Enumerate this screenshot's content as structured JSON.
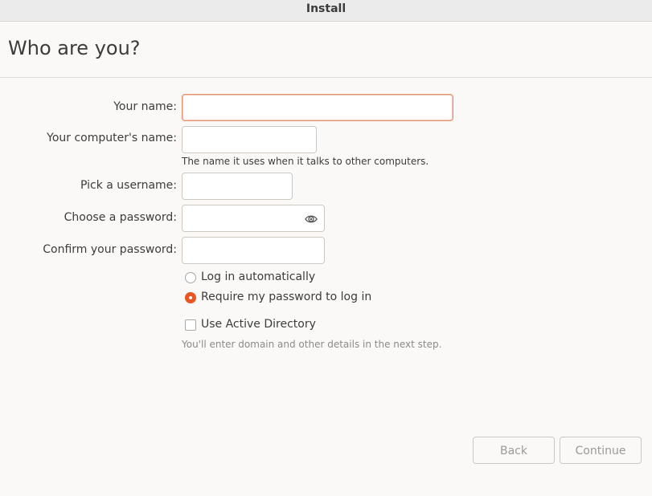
{
  "window": {
    "title": "Install"
  },
  "page": {
    "title": "Who are you?"
  },
  "form": {
    "name_label": "Your name:",
    "name_value": "",
    "computer_label": "Your computer's name:",
    "computer_value": "",
    "computer_hint": "The name it uses when it talks to other computers.",
    "username_label": "Pick a username:",
    "username_value": "",
    "password_label": "Choose a password:",
    "password_value": "",
    "confirm_label": "Confirm your password:",
    "confirm_value": "",
    "login_auto_label": "Log in automatically",
    "login_require_label": "Require my password to log in",
    "login_selected": "Require my password to log in",
    "ad_label": "Use Active Directory",
    "ad_checked": false,
    "ad_hint": "You'll enter domain and other details in the next step."
  },
  "icons": {
    "password_toggle": "eye-icon"
  },
  "colors": {
    "accent": "#e95420",
    "focus_border": "#e9906e"
  },
  "footer": {
    "back_label": "Back",
    "continue_label": "Continue"
  }
}
